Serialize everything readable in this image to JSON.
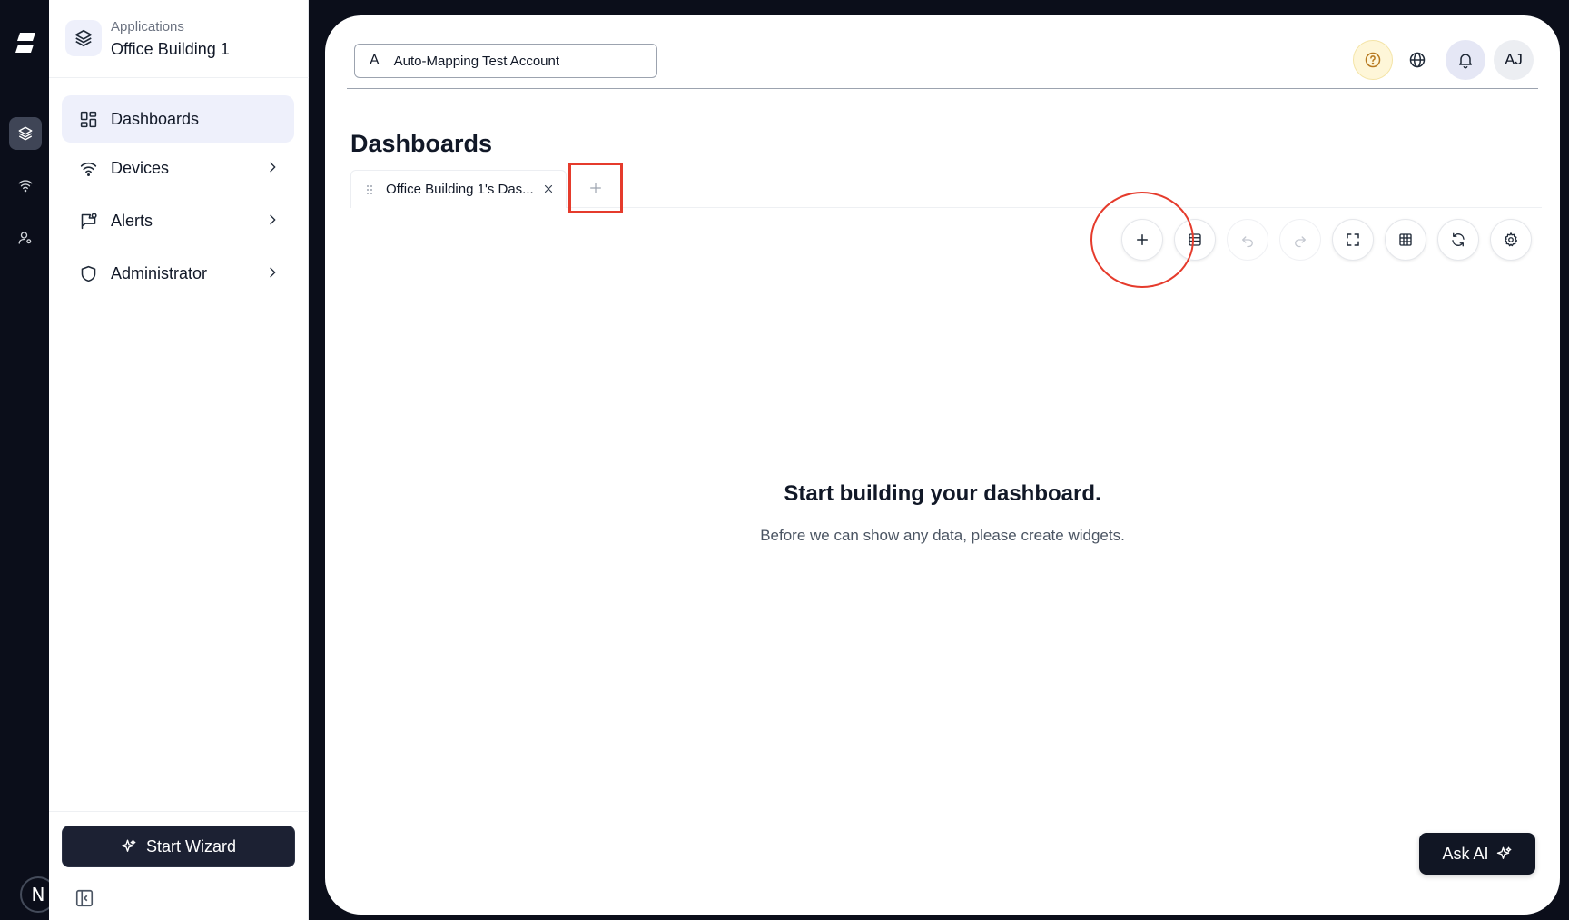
{
  "rail": {
    "avatar_initial": "N",
    "icons": [
      "brand-logo-icon",
      "layers-icon",
      "wifi-icon",
      "user-settings-icon"
    ]
  },
  "sidebar": {
    "app_kicker": "Applications",
    "app_name": "Office Building 1",
    "items": [
      {
        "label": "Dashboards",
        "icon": "dashboard-grid-icon",
        "active": true
      },
      {
        "label": "Devices",
        "icon": "wifi-icon",
        "has_chevron": true
      },
      {
        "label": "Alerts",
        "icon": "alert-flag-icon",
        "has_chevron": true
      },
      {
        "label": "Administrator",
        "icon": "shield-icon",
        "has_chevron": true
      }
    ],
    "wizard_label": "Start Wizard"
  },
  "header": {
    "account_initial": "A",
    "account_name": "Auto-Mapping Test Account",
    "avatar_initials": "AJ"
  },
  "main": {
    "title": "Dashboards",
    "tabs": [
      {
        "label": "Office Building 1's Das..."
      }
    ],
    "empty_title": "Start building your dashboard.",
    "empty_subtitle": "Before we can show any data, please create widgets.",
    "ask_ai_label": "Ask AI"
  },
  "colors": {
    "accent_dark": "#1c2133",
    "highlight_red": "#e53b2c",
    "active_nav_bg": "#eef0fb",
    "help_bg": "#fef6d8"
  }
}
